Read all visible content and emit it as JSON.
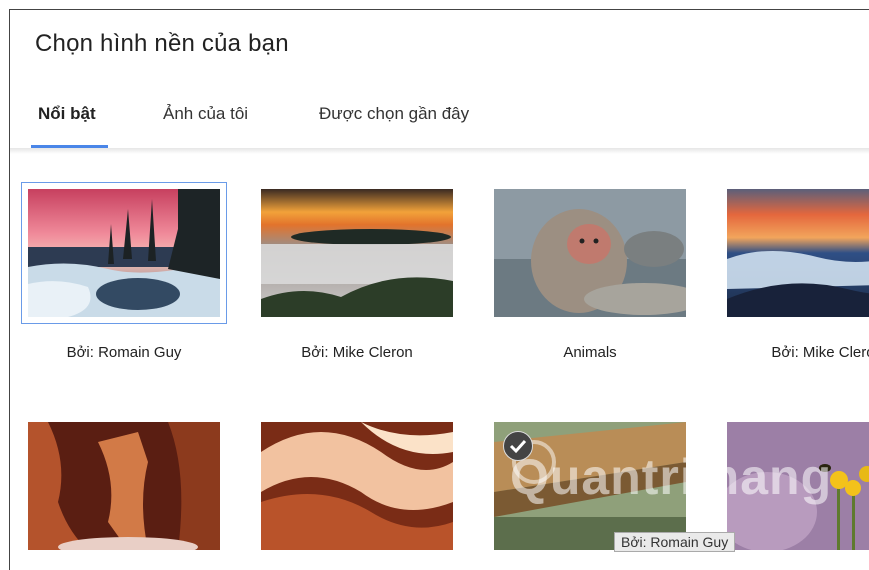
{
  "dialog": {
    "title": "Chọn hình nền của bạn"
  },
  "tabs": [
    {
      "label": "Nổi bật",
      "active": true
    },
    {
      "label": "Ảnh của tôi",
      "active": false
    },
    {
      "label": "Được chọn gần đây",
      "active": false
    }
  ],
  "wallpapers": [
    {
      "caption": "Bởi: Romain Guy",
      "subject": "frozen lake at sunset",
      "selected": true
    },
    {
      "caption": "Bởi: Mike Cleron",
      "subject": "fog over hills at sunset"
    },
    {
      "caption": "Animals",
      "subject": "snow monkey in hot spring"
    },
    {
      "caption": "Bởi: Mike Clero",
      "subject": "sea of clouds at sunset"
    },
    {
      "caption": "",
      "subject": "red sandstone canyon"
    },
    {
      "caption": "",
      "subject": "slot canyon light"
    },
    {
      "caption": "",
      "subject": "wooden railing close-up",
      "checked": true
    },
    {
      "caption": "",
      "subject": "yellow wildflowers with bee"
    }
  ],
  "tooltip": "Bởi: Romain Guy",
  "watermark": "Quantrimang"
}
